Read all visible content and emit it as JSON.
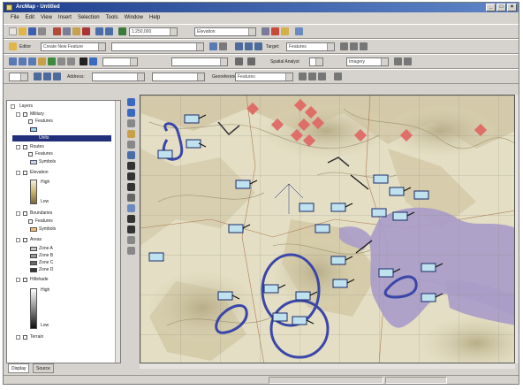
{
  "window": {
    "title": "ArcMap - Untitled"
  },
  "menu": [
    "File",
    "Edit",
    "View",
    "Insert",
    "Selection",
    "Tools",
    "Window",
    "Help"
  ],
  "toolbar": {
    "scale_value": "1:250,000",
    "editor_label": "Editor",
    "task_value": "Create New Feature",
    "target_label": "Target:",
    "target_value": "Features",
    "layer_value": "Features",
    "geocode_label": "Address:",
    "spatial_label": "Spatial Analyst",
    "layer_combo2": "Elevation",
    "georef_label": "Georeferencing",
    "georef_layer": "Imagery"
  },
  "toc": {
    "title": "Layers",
    "items": [
      {
        "label": "Layers",
        "kind": "frame"
      },
      {
        "label": "Military",
        "kind": "group"
      },
      {
        "label": "Features",
        "kind": "layer"
      },
      {
        "label": "Units",
        "kind": "selected"
      },
      {
        "label": "Routes",
        "kind": "group"
      },
      {
        "label": "Features",
        "kind": "layer"
      },
      {
        "label": "Symbols",
        "kind": "sub"
      },
      {
        "label": "Elevation",
        "kind": "group"
      },
      {
        "label": "High",
        "kind": "legend"
      },
      {
        "label": "Low",
        "kind": "legend"
      },
      {
        "label": "Boundaries",
        "kind": "group"
      },
      {
        "label": "Features",
        "kind": "layer"
      },
      {
        "label": "Symbols",
        "kind": "sub"
      },
      {
        "label": "Areas",
        "kind": "group"
      },
      {
        "label": "Zone A",
        "kind": "sub"
      },
      {
        "label": "Zone B",
        "kind": "sub"
      },
      {
        "label": "Zone C",
        "kind": "sub"
      },
      {
        "label": "Zone D",
        "kind": "sub"
      },
      {
        "label": "Hillshade",
        "kind": "group"
      },
      {
        "label": "High",
        "kind": "legend"
      },
      {
        "label": "Low",
        "kind": "legend"
      },
      {
        "label": "Terrain",
        "kind": "group"
      }
    ],
    "tabs": [
      "Display",
      "Source"
    ]
  },
  "status": {
    "message": "",
    "coords": ""
  },
  "colors": {
    "water": "#a99cc8",
    "annotation_blue": "#3a46a8",
    "marker_red": "#e06a66",
    "label_fill": "#bfe2ee"
  }
}
